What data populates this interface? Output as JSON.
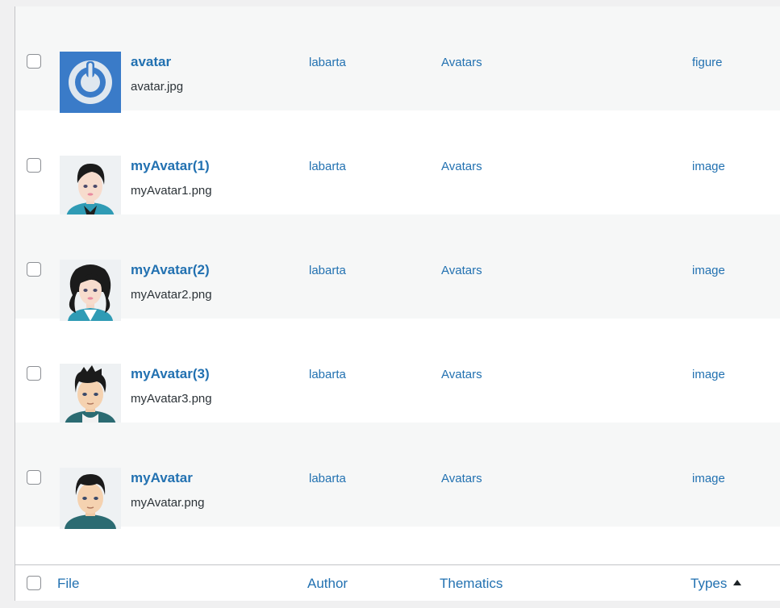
{
  "columns": {
    "file": "File",
    "author": "Author",
    "thematics": "Thematics",
    "types": "Types"
  },
  "rows": [
    {
      "title": "avatar",
      "filename": "avatar.jpg",
      "author": "labarta",
      "thematics": "Avatars",
      "type": "figure",
      "thumbnail": "power-logo-icon"
    },
    {
      "title": "myAvatar(1)",
      "filename": "myAvatar1.png",
      "author": "labarta",
      "thematics": "Avatars",
      "type": "image",
      "thumbnail": "woman-short-hair-avatar-icon"
    },
    {
      "title": "myAvatar(2)",
      "filename": "myAvatar2.png",
      "author": "labarta",
      "thematics": "Avatars",
      "type": "image",
      "thumbnail": "woman-curly-hair-avatar-icon"
    },
    {
      "title": "myAvatar(3)",
      "filename": "myAvatar3.png",
      "author": "labarta",
      "thematics": "Avatars",
      "type": "image",
      "thumbnail": "man-spiky-hair-avatar-icon"
    },
    {
      "title": "myAvatar",
      "filename": "myAvatar.png",
      "author": "labarta",
      "thematics": "Avatars",
      "type": "image",
      "thumbnail": "man-short-hair-avatar-icon"
    }
  ],
  "colors": {
    "link": "#2271b1",
    "row_alt": "#f6f7f7",
    "border": "#c3c4c7"
  }
}
